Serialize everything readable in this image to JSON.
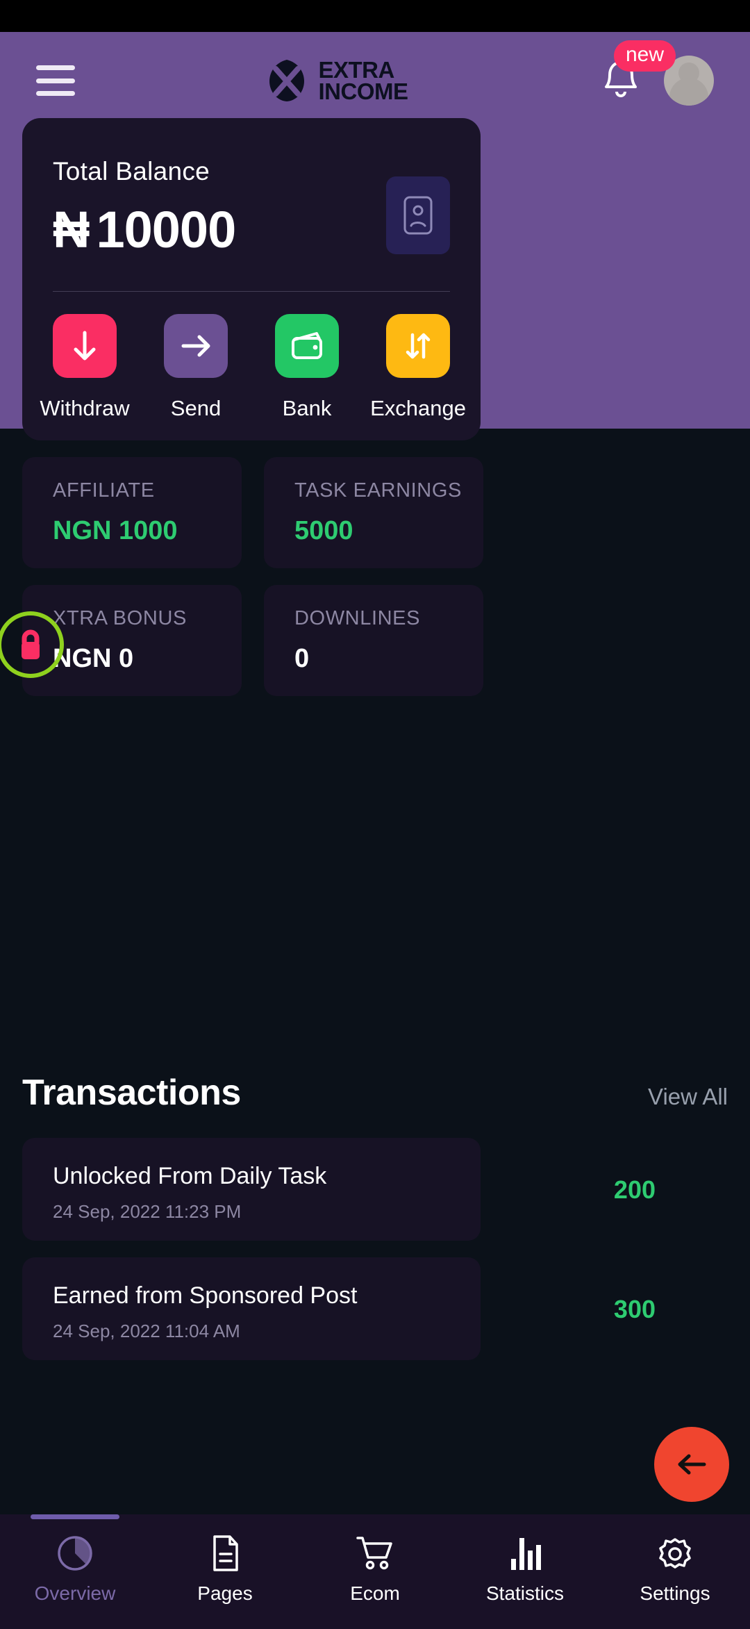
{
  "header": {
    "menu_icon": "hamburger-icon",
    "brand_line1": "EXTRA",
    "brand_line2": "INCOME",
    "notification_icon": "bell-icon",
    "notification_badge": "new",
    "avatar_icon": "user-avatar-icon"
  },
  "balance": {
    "label": "Total Balance",
    "currency_symbol": "₦",
    "amount": "10000",
    "card_icon": "id-card-icon"
  },
  "actions": [
    {
      "label": "Withdraw",
      "icon": "arrow-down-icon",
      "color": "#fa2e63"
    },
    {
      "label": "Send",
      "icon": "arrow-right-icon",
      "color": "#6b5093"
    },
    {
      "label": "Bank",
      "icon": "wallet-icon",
      "color": "#23c765"
    },
    {
      "label": "Exchange",
      "icon": "exchange-arrows-icon",
      "color": "#feb912"
    }
  ],
  "stats": [
    {
      "title": "AFFILIATE",
      "value": "NGN 1000",
      "value_color": "#2ecc71",
      "locked": false
    },
    {
      "title": "TASK EARNINGS",
      "value": "5000",
      "value_color": "#2ecc71",
      "locked": false
    },
    {
      "title": "XTRA BONUS",
      "value": "NGN 0",
      "value_color": "#ffffff",
      "locked": true,
      "lock_icon": "lock-icon"
    },
    {
      "title": "DOWNLINES",
      "value": "0",
      "value_color": "#ffffff",
      "locked": false
    }
  ],
  "transactions": {
    "title": "Transactions",
    "view_all": "View All",
    "items": [
      {
        "name": "Unlocked From Daily Task",
        "date": "24 Sep, 2022 11:23 PM",
        "amount": "200"
      },
      {
        "name": "Earned from Sponsored Post",
        "date": "24 Sep, 2022 11:04 AM",
        "amount": "300"
      }
    ]
  },
  "fab": {
    "icon": "arrow-left-icon",
    "color": "#f0452f"
  },
  "bottom_nav": [
    {
      "label": "Overview",
      "icon": "pie-chart-icon",
      "active": true
    },
    {
      "label": "Pages",
      "icon": "document-icon",
      "active": false
    },
    {
      "label": "Ecom",
      "icon": "shopping-cart-icon",
      "active": false
    },
    {
      "label": "Statistics",
      "icon": "bar-chart-icon",
      "active": false
    },
    {
      "label": "Settings",
      "icon": "gear-icon",
      "active": false
    }
  ]
}
